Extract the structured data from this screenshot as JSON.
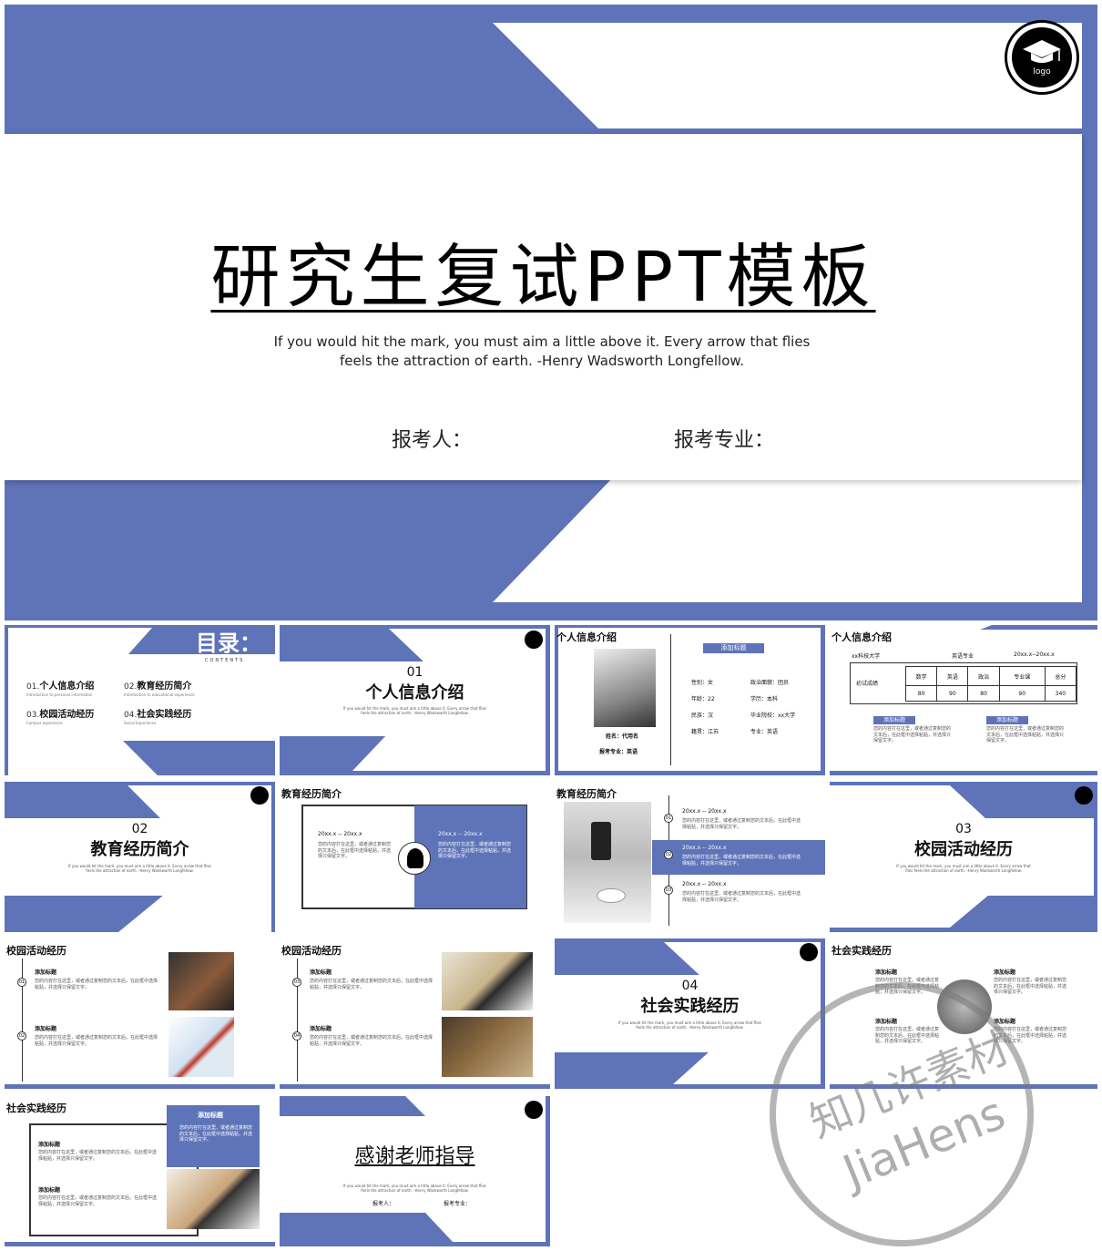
{
  "hero": {
    "title": "研究生复试PPT模板",
    "quote": "If you would hit the mark, you must aim a little above it. Every arrow that flies feels the attraction of earth. -Henry Wadsworth Longfellow.",
    "applicant_label": "报考人：",
    "major_label": "报考专业：",
    "logo_text": "logo"
  },
  "colors": {
    "accent": "#5e73b8",
    "white": "#ffffff",
    "dark": "#000000"
  },
  "contents": {
    "title": "目录：",
    "subtitle": "CONTENTS",
    "items": [
      {
        "num": "01.",
        "label": "个人信息介绍",
        "en": "Introduction to personal information"
      },
      {
        "num": "02.",
        "label": "教育经历简介",
        "en": "Introduction to educational experience"
      },
      {
        "num": "03.",
        "label": "校园活动经历",
        "en": "Campus experience"
      },
      {
        "num": "04.",
        "label": "社会实践经历",
        "en": "Social Experience"
      }
    ]
  },
  "short_quote": "If you would hit the mark, you must aim a little above it. Every arrow that flies feels the attraction of earth. -Henry Wadsworth Longfellow.",
  "sections": [
    {
      "num": "01",
      "title": "个人信息介绍"
    },
    {
      "num": "02",
      "title": "教育经历简介"
    },
    {
      "num": "03",
      "title": "校园活动经历"
    },
    {
      "num": "04",
      "title": "社会实践经历"
    }
  ],
  "profile": {
    "header": "个人信息介绍",
    "tag": "添加标题",
    "name": "姓名：代用名",
    "major": "报考专业：英语",
    "fields": [
      "性别：女",
      "政治面貌：团员",
      "年龄：22",
      "学历：本科",
      "民族：汉",
      "毕业院校：xx大学",
      "籍贯：江苏",
      "专业：英语"
    ]
  },
  "scores": {
    "header": "个人信息介绍",
    "school": "xx科技大学",
    "major": "英语专业",
    "period": "20xx.x--20xx.x",
    "row_label": "初试成绩",
    "columns": [
      "数学",
      "英语",
      "政治",
      "专业课",
      "总分"
    ],
    "values": [
      "80",
      "90",
      "80",
      "90",
      "340"
    ],
    "notes": [
      {
        "tag": "添加标题",
        "text": "您的内容打在这里，或者通过复制您的文本后，在此框中选择粘贴，并选择只保留文字。"
      },
      {
        "tag": "添加标题",
        "text": "您的内容打在这里，或者通过复制您的文本后，在此框中选择粘贴，并选择只保留文字。"
      }
    ]
  },
  "edu_intro": {
    "header": "教育经历简介",
    "left_date": "20xx.x -- 20xx.x",
    "left_text": "您的内容打在这里，或者通过复制您的文本后，在此框中选择粘贴，并选择只保留文字。",
    "right_date": "20xx.x -- 20xx.x",
    "right_text": "您的内容打在这里，或者通过复制您的文本后，在此框中选择粘贴，并选择只保留文字。"
  },
  "edu_timeline": {
    "header": "教育经历简介",
    "items": [
      {
        "num": "01",
        "date": "20xx.x -- 20xx.x",
        "text": "您的内容打在这里，或者通过复制您的文本后，在此框中选择粘贴，并选择只保留文字。"
      },
      {
        "num": "02",
        "date": "20xx.x -- 20xx.x",
        "text": "您的内容打在这里，或者通过复制您的文本后，在此框中选择粘贴，并选择只保留文字。"
      },
      {
        "num": "03",
        "date": "20xx.x -- 20xx.x",
        "text": "您的内容打在这里，或者通过复制您的文本后，在此框中选择粘贴，并选择只保留文字。"
      }
    ]
  },
  "campus_a": {
    "header": "校园活动经历",
    "items": [
      {
        "num": "01",
        "title": "添加标题",
        "text": "您的内容打在这里，或者通过复制您的文本后，在此框中选择粘贴，并选择只保留文字。"
      },
      {
        "num": "02",
        "title": "添加标题",
        "text": "您的内容打在这里，或者通过复制您的文本后，在此框中选择粘贴，并选择只保留文字。"
      }
    ]
  },
  "campus_b": {
    "header": "校园活动经历",
    "items": [
      {
        "num": "03",
        "title": "添加标题",
        "text": "您的内容打在这里，或者通过复制您的文本后，在此框中选择粘贴，并选择只保留文字。"
      },
      {
        "num": "04",
        "title": "添加标题",
        "text": "您的内容打在这里，或者通过复制您的文本后，在此框中选择粘贴，并选择只保留文字。"
      }
    ]
  },
  "social_a": {
    "header": "社会实践经历",
    "items": [
      {
        "title": "添加标题",
        "text": "您的内容打在这里，或者通过复制您的文本后，在此框中选择粘贴，并选择只保留文字。"
      },
      {
        "title": "添加标题",
        "text": "您的内容打在这里，或者通过复制您的文本后，在此框中选择粘贴，并选择只保留文字。"
      },
      {
        "title": "添加标题",
        "text": "您的内容打在这里，或者通过复制您的文本后，在此框中选择粘贴，并选择只保留文字。"
      },
      {
        "title": "添加标题",
        "text": "您的内容打在这里，或者通过复制您的文本后，在此框中选择粘贴，并选择只保留文字。"
      }
    ]
  },
  "social_b": {
    "header": "社会实践经历",
    "tag": "添加标题",
    "tag_text": "您的内容打在这里，或者通过复制您的文本后，在此框中选择粘贴，并选择只保留文字。",
    "items": [
      {
        "title": "添加标题",
        "text": "您的内容打在这里，或者通过复制您的文本后，在此框中选择粘贴，并选择只保留文字。"
      },
      {
        "title": "添加标题",
        "text": "您的内容打在这里，或者通过复制您的文本后，在此框中选择粘贴，并选择只保留文字。"
      }
    ]
  },
  "thanks": {
    "title": "感谢老师指导",
    "quote": "If you would hit the mark, you must aim a little above it. Every arrow that flies feels the attraction of earth. -Henry Wadsworth Longfellow.",
    "applicant_label": "报考人：",
    "major_label": "报考专业："
  },
  "watermark": {
    "line1": "知几许素材",
    "line2": "JiaHens"
  }
}
